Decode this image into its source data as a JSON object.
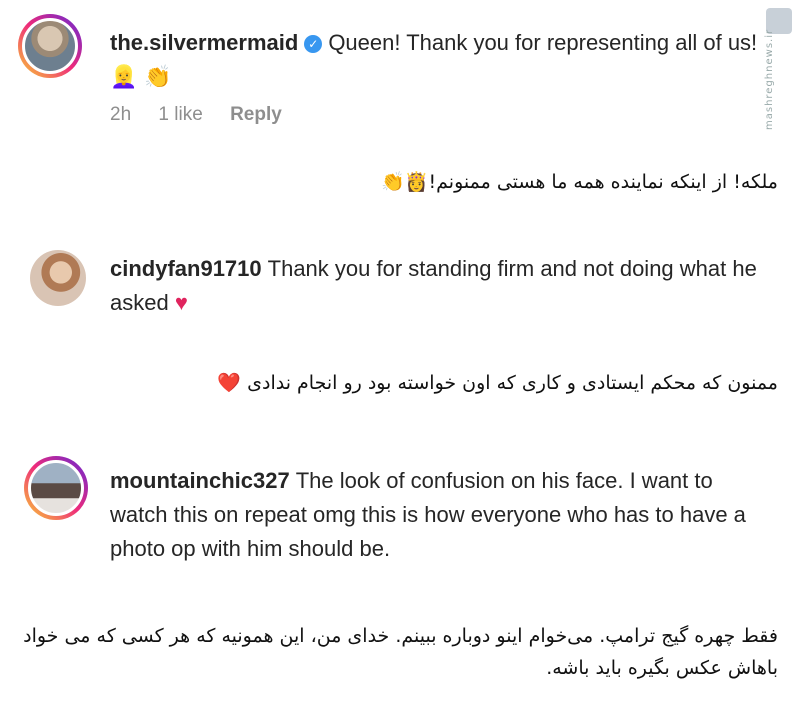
{
  "comments": [
    {
      "username": "the.silvermermaid",
      "verified": true,
      "text": "Queen! Thank you for representing all of us!",
      "emoji": "👱‍♀️ 👏",
      "time": "2h",
      "likes": "1 like",
      "reply": "Reply",
      "translation": "ملکه! از اینکه نماینده همه ما هستی ممنونم!👸👏"
    },
    {
      "username": "cindyfan91710",
      "text": "Thank you for standing firm and not doing what he asked",
      "emoji": "💗",
      "translation": "ممنون که محکم ایستادی و کاری که اون خواسته بود رو انجام ندادی ❤️"
    },
    {
      "username": "mountainchic327",
      "text": "The look of confusion on his face. I want to watch this on repeat omg this is how everyone who has to have a photo op with him should be.",
      "translation": "فقط چهره گیج ترامپ. می‌خوام اینو دوباره ببینم. خدای من، این همونیه که هر کسی که می خواد باهاش عکس بگیره باید باشه."
    }
  ],
  "watermark": "mashreghnews.ir",
  "colors": {
    "verified": "#3897f0",
    "meta": "#8e8e8e",
    "ring": "#ee2a7b"
  }
}
